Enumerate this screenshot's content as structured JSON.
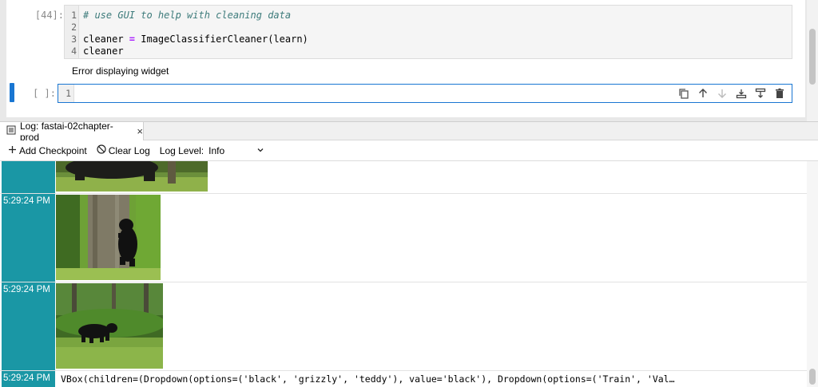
{
  "notebook": {
    "cell1": {
      "prompt": "[44]:",
      "lines": [
        {
          "n": "1",
          "text": "# use GUI to help with cleaning data"
        },
        {
          "n": "2",
          "text": ""
        },
        {
          "n": "3",
          "text_pre": "cleaner ",
          "op": "=",
          "text_post": " ImageClassifierCleaner(learn)"
        },
        {
          "n": "4",
          "text": "cleaner"
        }
      ],
      "output": "Error displaying widget"
    },
    "cell2": {
      "prompt": "[ ]:",
      "line_number": "1"
    },
    "cell_toolbar_icons": [
      "copy-icon",
      "move-up-icon",
      "move-down-icon",
      "insert-above-icon",
      "insert-below-icon",
      "delete-icon"
    ]
  },
  "log_panel": {
    "tab_title": "Log: fastai-02chapter-prod",
    "tab_close": "×",
    "toolbar": {
      "add_checkpoint": "Add Checkpoint",
      "clear_log": "Clear Log",
      "log_level_label": "Log Level:",
      "log_level_value": "Info"
    },
    "entries": [
      {
        "time": "",
        "kind": "image",
        "image": "bear-walking-cropped"
      },
      {
        "time": "5:29:24 PM",
        "kind": "image",
        "image": "bear-cub-on-tree"
      },
      {
        "time": "5:29:24 PM",
        "kind": "image",
        "image": "black-bear-in-forest"
      },
      {
        "time": "5:29:24 PM",
        "kind": "text",
        "text": "VBox(children=(Dropdown(options=('black', 'grizzly', 'teddy'), value='black'), Dropdown(options=('Train', 'Val…"
      }
    ]
  },
  "colors": {
    "accent": "#1976d2",
    "timestamp_bg": "#1a97a5"
  }
}
